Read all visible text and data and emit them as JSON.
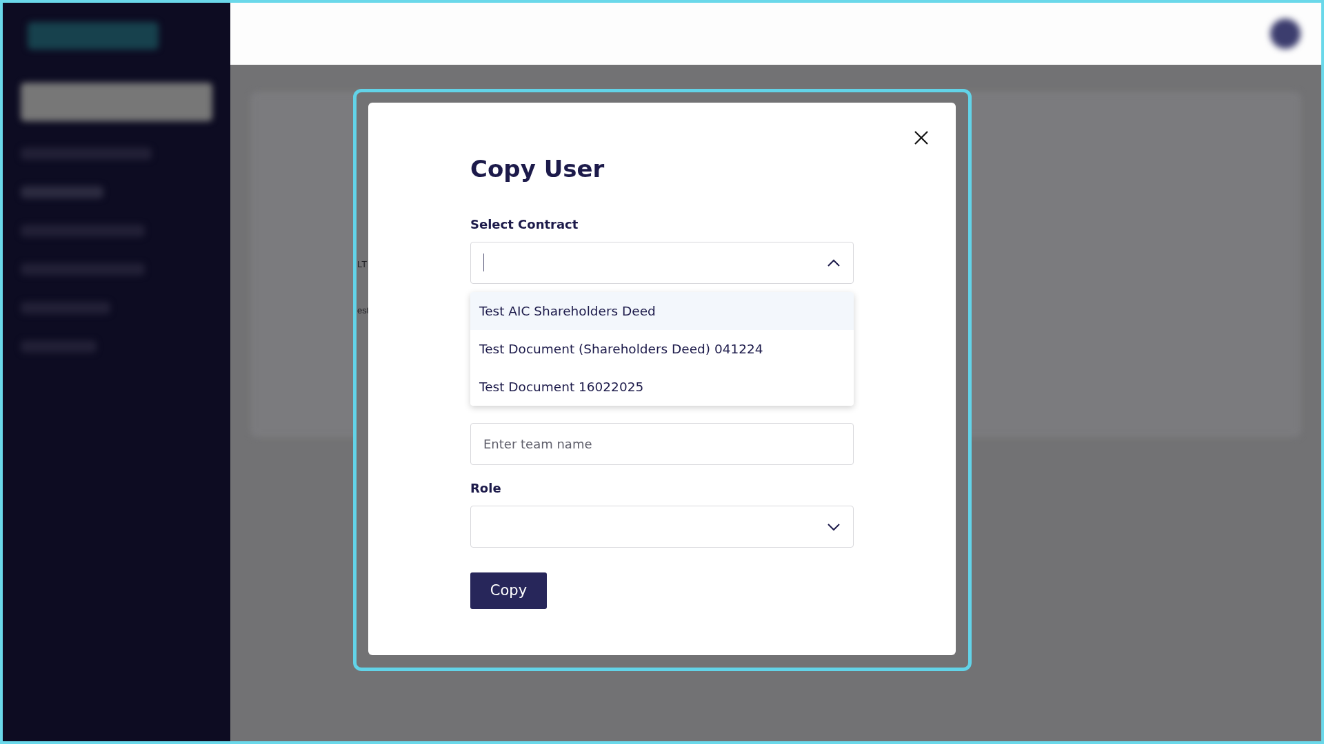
{
  "background_fragments": [
    {
      "text": "LT"
    },
    {
      "text": "est"
    }
  ],
  "modal": {
    "title": "Copy User",
    "contract": {
      "label": "Select Contract",
      "expanded": true,
      "options": [
        {
          "label": "Test AIC Shareholders Deed",
          "selected": true
        },
        {
          "label": "Test Document (Shareholders Deed) 041224",
          "selected": false
        },
        {
          "label": "Test Document 16022025",
          "selected": false
        }
      ]
    },
    "team_name": {
      "placeholder": "Enter team name"
    },
    "role": {
      "label": "Role",
      "expanded": false
    },
    "button": "Copy"
  }
}
